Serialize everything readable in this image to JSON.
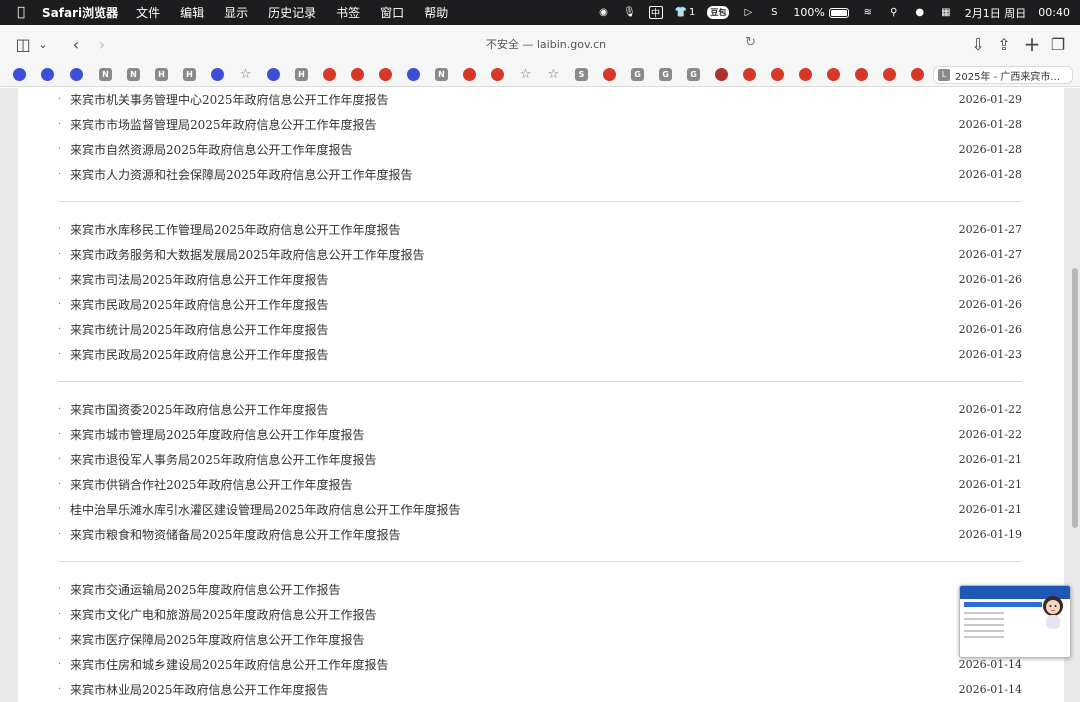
{
  "menubar": {
    "app_name": "Safari浏览器",
    "items": [
      "文件",
      "编辑",
      "显示",
      "历史记录",
      "书签",
      "窗口",
      "帮助"
    ],
    "status": {
      "input_method": "中",
      "counter": "1",
      "doubao_label": "豆包",
      "battery": "100%",
      "date": "2月1日 周日",
      "time": "00:40"
    }
  },
  "toolbar": {
    "address": "不安全 — laibin.gov.cn"
  },
  "favorites": [
    {
      "kind": "paw",
      "glyph": "",
      "icon": "baidu-paw-icon"
    },
    {
      "kind": "paw",
      "glyph": "",
      "icon": "baidu-paw-icon"
    },
    {
      "kind": "paw",
      "glyph": "",
      "icon": "baidu-paw-icon"
    },
    {
      "kind": "letter",
      "glyph": "N",
      "icon": "letter-n-icon"
    },
    {
      "kind": "letter",
      "glyph": "N",
      "icon": "letter-n-icon"
    },
    {
      "kind": "letter",
      "glyph": "H",
      "icon": "letter-h-icon"
    },
    {
      "kind": "letter",
      "glyph": "H",
      "icon": "letter-h-icon"
    },
    {
      "kind": "paw",
      "glyph": "",
      "icon": "baidu-paw-icon"
    },
    {
      "kind": "star",
      "glyph": "☆",
      "icon": "star-icon"
    },
    {
      "kind": "paw",
      "glyph": "",
      "icon": "baidu-paw-icon"
    },
    {
      "kind": "letter",
      "glyph": "H",
      "icon": "letter-h-icon"
    },
    {
      "kind": "emblem",
      "glyph": "",
      "icon": "government-emblem-icon"
    },
    {
      "kind": "emblem",
      "glyph": "",
      "icon": "government-emblem-icon"
    },
    {
      "kind": "emblem",
      "glyph": "",
      "icon": "government-emblem-icon"
    },
    {
      "kind": "paw",
      "glyph": "",
      "icon": "baidu-paw-icon"
    },
    {
      "kind": "letter",
      "glyph": "N",
      "icon": "letter-n-icon"
    },
    {
      "kind": "emblem",
      "glyph": "",
      "icon": "government-emblem-icon"
    },
    {
      "kind": "emblem",
      "glyph": "",
      "icon": "government-emblem-icon"
    },
    {
      "kind": "star",
      "glyph": "☆",
      "icon": "star-icon"
    },
    {
      "kind": "star",
      "glyph": "☆",
      "icon": "star-icon"
    },
    {
      "kind": "letter",
      "glyph": "S",
      "icon": "letter-s-icon"
    },
    {
      "kind": "emblem",
      "glyph": "",
      "icon": "government-emblem-icon"
    },
    {
      "kind": "letter",
      "glyph": "G",
      "icon": "letter-g-icon"
    },
    {
      "kind": "letter",
      "glyph": "G",
      "icon": "letter-g-icon"
    },
    {
      "kind": "letter",
      "glyph": "G",
      "icon": "letter-g-icon"
    },
    {
      "kind": "ruby",
      "glyph": "",
      "icon": "ruby-icon"
    },
    {
      "kind": "emblem",
      "glyph": "",
      "icon": "government-emblem-icon"
    },
    {
      "kind": "emblem",
      "glyph": "",
      "icon": "government-emblem-icon"
    },
    {
      "kind": "emblem",
      "glyph": "",
      "icon": "government-emblem-icon"
    },
    {
      "kind": "emblem",
      "glyph": "",
      "icon": "government-emblem-icon"
    },
    {
      "kind": "emblem",
      "glyph": "",
      "icon": "government-emblem-icon"
    },
    {
      "kind": "emblem",
      "glyph": "",
      "icon": "government-emblem-icon"
    },
    {
      "kind": "emblem",
      "glyph": "",
      "icon": "government-emblem-icon"
    }
  ],
  "tab": {
    "icon_letter": "L",
    "title": "2025年 - 广西来宾市..."
  },
  "groups": [
    [
      {
        "title": "来宾市机关事务管理中心2025年政府信息公开工作年度报告",
        "date": "2026-01-29"
      },
      {
        "title": "来宾市市场监督管理局2025年政府信息公开工作年度报告",
        "date": "2026-01-28"
      },
      {
        "title": "来宾市自然资源局2025年政府信息公开工作年度报告",
        "date": "2026-01-28"
      },
      {
        "title": "来宾市人力资源和社会保障局2025年政府信息公开工作年度报告",
        "date": "2026-01-28"
      }
    ],
    [
      {
        "title": "来宾市水库移民工作管理局2025年政府信息公开工作年度报告",
        "date": "2026-01-27"
      },
      {
        "title": "来宾市政务服务和大数据发展局2025年政府信息公开工作年度报告",
        "date": "2026-01-27"
      },
      {
        "title": "来宾市司法局2025年政府信息公开工作年度报告",
        "date": "2026-01-26"
      },
      {
        "title": "来宾市民政局2025年政府信息公开工作年度报告",
        "date": "2026-01-26"
      },
      {
        "title": "来宾市统计局2025年政府信息公开工作年度报告",
        "date": "2026-01-26"
      },
      {
        "title": "来宾市民政局2025年政府信息公开工作年度报告",
        "date": "2026-01-23"
      }
    ],
    [
      {
        "title": "来宾市国资委2025年政府信息公开工作年度报告",
        "date": "2026-01-22"
      },
      {
        "title": "来宾市城市管理局2025年度政府信息公开工作年度报告",
        "date": "2026-01-22"
      },
      {
        "title": "来宾市退役军人事务局2025年政府信息公开工作年度报告",
        "date": "2026-01-21"
      },
      {
        "title": "来宾市供销合作社2025年政府信息公开工作年度报告",
        "date": "2026-01-21"
      },
      {
        "title": "桂中治旱乐滩水库引水灌区建设管理局2025年政府信息公开工作年度报告",
        "date": "2026-01-21"
      },
      {
        "title": "来宾市粮食和物资储备局2025年度政府信息公开工作年度报告",
        "date": "2026-01-19"
      }
    ],
    [
      {
        "title": "来宾市交通运输局2025年度政府信息公开工作报告",
        "date": ""
      },
      {
        "title": "来宾市文化广电和旅游局2025年度政府信息公开工作报告",
        "date": ""
      },
      {
        "title": "来宾市医疗保障局2025年度政府信息公开工作年度报告",
        "date": ""
      },
      {
        "title": "来宾市住房和城乡建设局2025年政府信息公开工作年度报告",
        "date": "2026-01-14"
      },
      {
        "title": "来宾市林业局2025年政府信息公开工作年度报告",
        "date": "2026-01-14"
      }
    ]
  ]
}
